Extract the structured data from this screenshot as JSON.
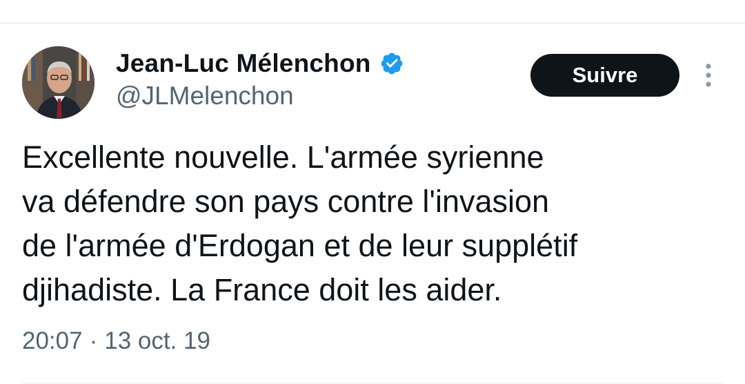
{
  "tweet": {
    "author": {
      "display_name": "Jean-Luc Mélenchon",
      "handle": "@JLMelenchon",
      "verified": true,
      "verified_icon": "verified-badge-icon",
      "avatar_icon": "profile-photo"
    },
    "follow_button_label": "Suivre",
    "more_icon": "more-options-icon",
    "text_lines": [
      "Excellente nouvelle. L'armée syrienne",
      "va défendre son pays contre l'invasion",
      "de l'armée d'Erdogan et de leur supplétif",
      "djihadiste. La France doit les aider."
    ],
    "time": "20:07",
    "separator": "·",
    "date": "13 oct. 19"
  },
  "colors": {
    "text_primary": "#0f1419",
    "text_secondary": "#536471",
    "button_bg": "#0f1419",
    "verified_blue": "#1d9bf0",
    "divider": "#e5e8ea"
  }
}
